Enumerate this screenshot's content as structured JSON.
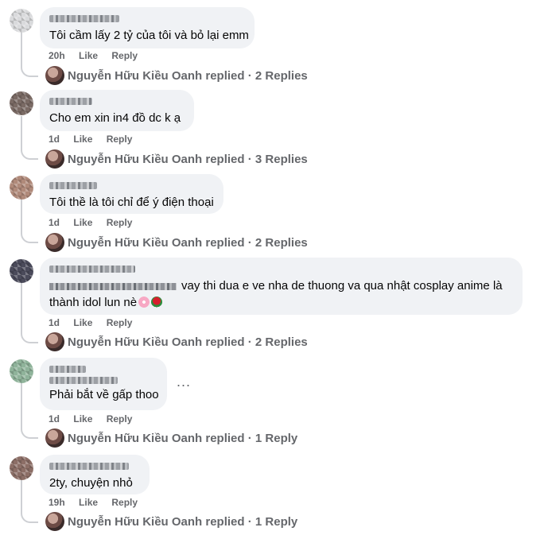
{
  "comments": [
    {
      "text": "Tôi cầm lấy 2 tỷ của tôi và bỏ lại emm",
      "time": "20h",
      "like": "Like",
      "reply": "Reply",
      "replied_by": "Nguyễn Hữu Kiều Oanh replied · 2 Replies",
      "avatar_color": "#d9dadc"
    },
    {
      "text": "Cho em xin in4 đồ dc k ạ",
      "time": "1d",
      "like": "Like",
      "reply": "Reply",
      "replied_by": "Nguyễn Hữu Kiều Oanh replied · 3 Replies",
      "avatar_color": "#7a6a64"
    },
    {
      "text": "Tôi thề là tôi chỉ để ý điện thoại",
      "time": "1d",
      "like": "Like",
      "reply": "Reply",
      "replied_by": "Nguyễn Hữu Kiều Oanh replied · 2 Replies",
      "avatar_color": "#b08a7a"
    },
    {
      "text_line1": "vay thi dua e ve nha de thuong va qua nhật cosplay anime là",
      "text_line2": "thành idol lun nè",
      "time": "1d",
      "like": "Like",
      "reply": "Reply",
      "replied_by": "Nguyễn Hữu Kiều Oanh replied · 2 Replies",
      "avatar_color": "#4a4a5a"
    },
    {
      "text": "Phải bắt về gấp thoo",
      "time": "1d",
      "like": "Like",
      "reply": "Reply",
      "replied_by": "Nguyễn Hữu Kiều Oanh replied · 1 Reply",
      "avatar_color": "#8fb39a",
      "more": "..."
    },
    {
      "text": "2ty, chuyện nhỏ",
      "time": "19h",
      "like": "Like",
      "reply": "Reply",
      "replied_by": "Nguyễn Hữu Kiều Oanh replied · 1 Reply",
      "avatar_color": "#8c6e66"
    }
  ]
}
